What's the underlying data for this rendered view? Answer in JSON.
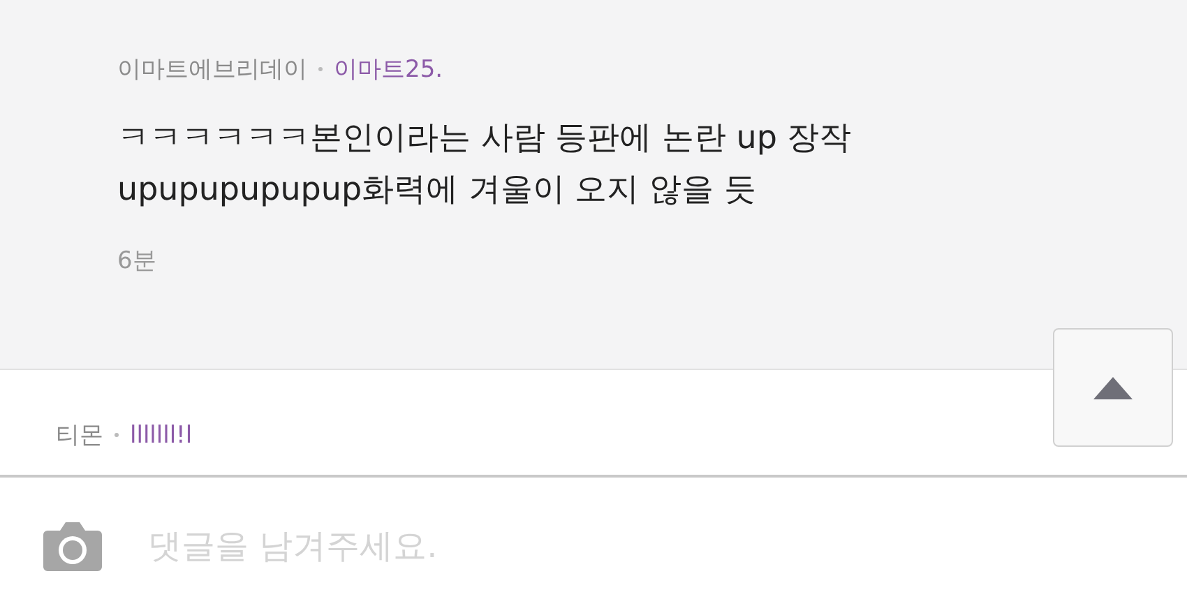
{
  "comments": [
    {
      "nickname": "이마트에브리데이",
      "reply_to": "이마트25.",
      "text": "ㅋㅋㅋㅋㅋㅋ본인이라는 사람 등판에 논란 up 장작 upupupupupup화력에 겨울이 오지 않을 듯",
      "time": "6분",
      "highlighted": true
    },
    {
      "nickname": "티몬",
      "reply_to": "lllllll!l",
      "highlighted": false
    }
  ],
  "comment_input": {
    "placeholder": "댓글을 남겨주세요."
  }
}
